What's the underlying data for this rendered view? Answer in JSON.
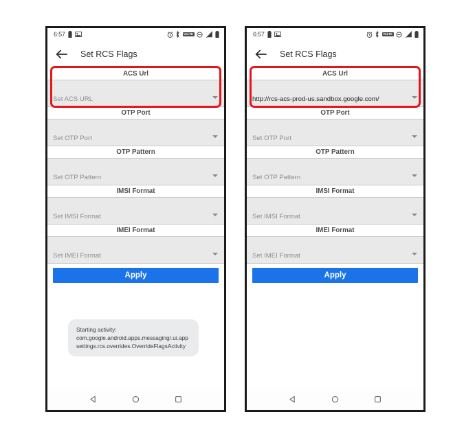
{
  "colors": {
    "accent_blue": "#1a73e8",
    "highlight_red": "#e8141b",
    "field_gray": "#e9e9e9",
    "toast_gray": "#e9ebec",
    "frame_black": "#1a1a1a",
    "placeholder_gray": "#8e8e8e",
    "value_black": "#1f1f1f"
  },
  "status_bar": {
    "clock": "6:57",
    "left_icons": [
      "battery-status-icon",
      "screenshot-icon"
    ],
    "right_icons": [
      "alarm-icon",
      "bluetooth-icon",
      "volte-icon",
      "do-not-disturb-icon",
      "signal-bars-icon",
      "battery-icon"
    ],
    "volte_label": "VoLTE"
  },
  "app_bar": {
    "back_icon": "back-arrow-icon",
    "title": "Set RCS Flags"
  },
  "fields": [
    {
      "label": "ACS Url",
      "placeholder": "Set ACS URL",
      "highlighted": true
    },
    {
      "label": "OTP Port",
      "placeholder": "Set OTP Port",
      "highlighted": false
    },
    {
      "label": "OTP Pattern",
      "placeholder": "Set OTP Pattern",
      "highlighted": false
    },
    {
      "label": "IMSI Format",
      "placeholder": "Set IMSI Format",
      "highlighted": false
    },
    {
      "label": "IMEI Format",
      "placeholder": "Set IMEI Format",
      "highlighted": false
    }
  ],
  "apply": {
    "label": "Apply"
  },
  "toast": {
    "text": "Starting activity: com.google.android.apps.messaging/.ui.appsettings.rcs.overrides.OverrideFlagsActivity"
  },
  "nav_bar": {
    "back": "nav-back-icon",
    "home": "nav-home-icon",
    "recents": "nav-recents-icon"
  },
  "left_phone": {
    "acs_url_value": "",
    "acs_url_display": "Set ACS URL",
    "acs_url_filled": false,
    "shows_toast": true
  },
  "right_phone": {
    "acs_url_value": "http://rcs-acs-prod-us.sandbox.google.com/",
    "acs_url_display": "http://rcs-acs-prod-us.sandbox.google.com/",
    "acs_url_filled": true,
    "shows_toast": false
  }
}
